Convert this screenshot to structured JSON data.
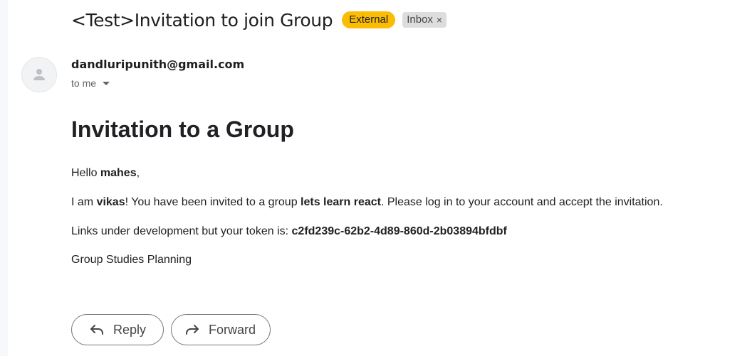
{
  "email": {
    "subject": "<Test>Invitation to join Group",
    "labels": {
      "external": "External",
      "inbox": "Inbox",
      "inbox_remove": "×"
    },
    "sender": "dandluripunith@gmail.com",
    "recipient": "to me"
  },
  "body": {
    "heading": "Invitation to a Group",
    "greeting": {
      "prefix": "Hello ",
      "name": "mahes",
      "suffix": ","
    },
    "invite": {
      "prefix": "I am ",
      "inviter": "vikas",
      "middle": "! You have been invited to a group ",
      "group": "lets learn react",
      "suffix": ". Please log in to your account and accept the invitation."
    },
    "token_line": {
      "prefix": "Links under development but your token is: ",
      "token": "c2fd239c-62b2-4d89-860d-2b03894bfdbf"
    },
    "signature": "Group Studies Planning"
  },
  "actions": {
    "reply": "Reply",
    "forward": "Forward"
  },
  "colors": {
    "external_badge": "#fbbc04",
    "inbox_badge": "#dddddd",
    "text": "#202124",
    "muted": "#5f6368"
  },
  "icons": {
    "avatar": "person-icon",
    "recipient_details": "caret-down-icon",
    "reply": "reply-arrow-icon",
    "forward": "forward-arrow-icon"
  }
}
